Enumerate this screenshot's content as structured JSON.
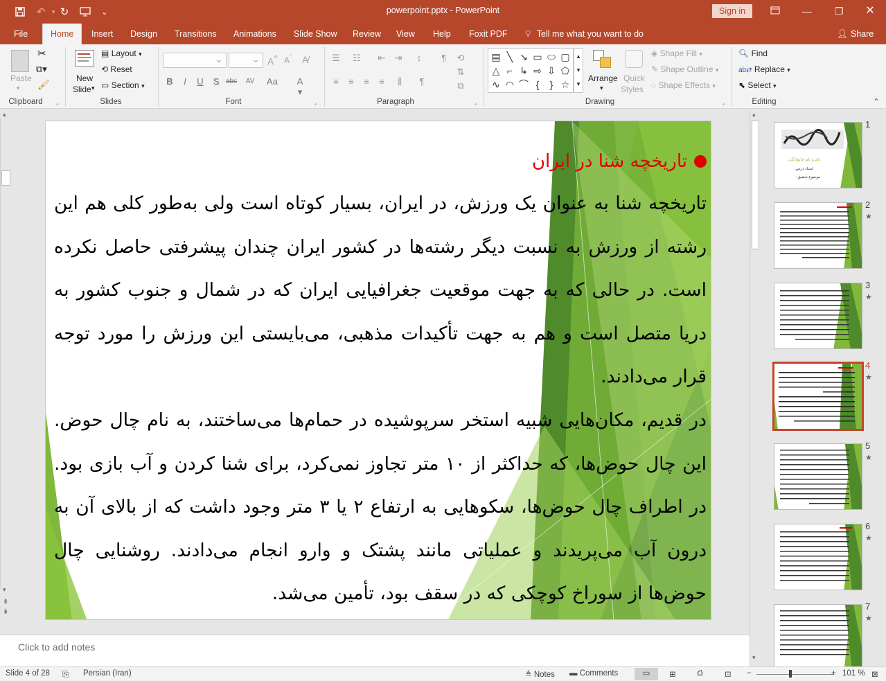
{
  "window": {
    "doc_title": "powerpoint.pptx  -  PowerPoint",
    "sign_in": "Sign in"
  },
  "tabs": [
    "File",
    "Home",
    "Insert",
    "Design",
    "Transitions",
    "Animations",
    "Slide Show",
    "Review",
    "View",
    "Help",
    "Foxit PDF"
  ],
  "tell_me": "Tell me what you want to do",
  "share": "Share",
  "ribbon": {
    "clipboard": {
      "paste": "Paste",
      "label": "Clipboard"
    },
    "slides": {
      "new_slide_1": "New",
      "new_slide_2": "Slide",
      "layout": "Layout",
      "reset": "Reset",
      "section": "Section",
      "label": "Slides"
    },
    "font": {
      "label": "Font"
    },
    "paragraph": {
      "label": "Paragraph"
    },
    "drawing": {
      "arrange": "Arrange",
      "quick_styles_1": "Quick",
      "quick_styles_2": "Styles",
      "shape_fill": "Shape Fill",
      "shape_outline": "Shape Outline",
      "shape_effects": "Shape Effects",
      "label": "Drawing"
    },
    "editing": {
      "find": "Find",
      "replace": "Replace",
      "select": "Select",
      "label": "Editing"
    }
  },
  "slide": {
    "title": "تاریخچه شنا در ایران",
    "para1": "تاریخچه شنا به عنوان یک ورزش، در ایران، بسیار کوتاه است ولی به‌طور کلی هم این رشته از ورزش به نسبت دیگر رشته‌ها در کشور ایران چندان پیشرفتی حاصل نکرده است. در حالی که به جهت موقعیت جغرافیایی ایران که در شمال و جنوب کشور به دریا متصل است و هم به جهت تأکیدات مذهبی، می‌بایستی این ورزش را مورد توجه قرار می‌دادند.",
    "para2": "در قدیم، مکان‌هایی شبیه استخر سرپوشیده در حمام‌ها می‌ساختند، به نام چال حوض. این چال حوض‌ها، که حداکثر از ۱۰ متر تجاوز نمی‌کرد، برای شنا کردن و آب بازی بود. در اطراف چال حوض‌ها، سکوهایی به ارتفاع ۲ یا ۳ متر وجود داشت که از بالای آن به درون آب می‌پریدند و عملیاتی مانند پشتک و وارو انجام می‌دادند. روشنایی چال حوض‌ها از سوراخ کوچکی که در سقف بود، تأمین می‌شد."
  },
  "notes_placeholder": "Click to add notes",
  "thumbnails": [
    {
      "num": "1",
      "star": "",
      "title": "نام و نام خانوادگی:",
      "line2": "استاد درس:",
      "line3": "موضوع تحقیق:"
    },
    {
      "num": "2",
      "star": "★"
    },
    {
      "num": "3",
      "star": "★"
    },
    {
      "num": "4",
      "star": "★"
    },
    {
      "num": "5",
      "star": "★"
    },
    {
      "num": "6",
      "star": "★"
    },
    {
      "num": "7",
      "star": "★"
    }
  ],
  "status": {
    "slide_info": "Slide 4 of 28",
    "language": "Persian (Iran)",
    "notes": "Notes",
    "comments": "Comments",
    "zoom": "101 %"
  },
  "colors": {
    "accent": "#b7472a",
    "green_light": "#8cc63f",
    "green_dark": "#4f8a2b",
    "title_red": "#e00000"
  }
}
